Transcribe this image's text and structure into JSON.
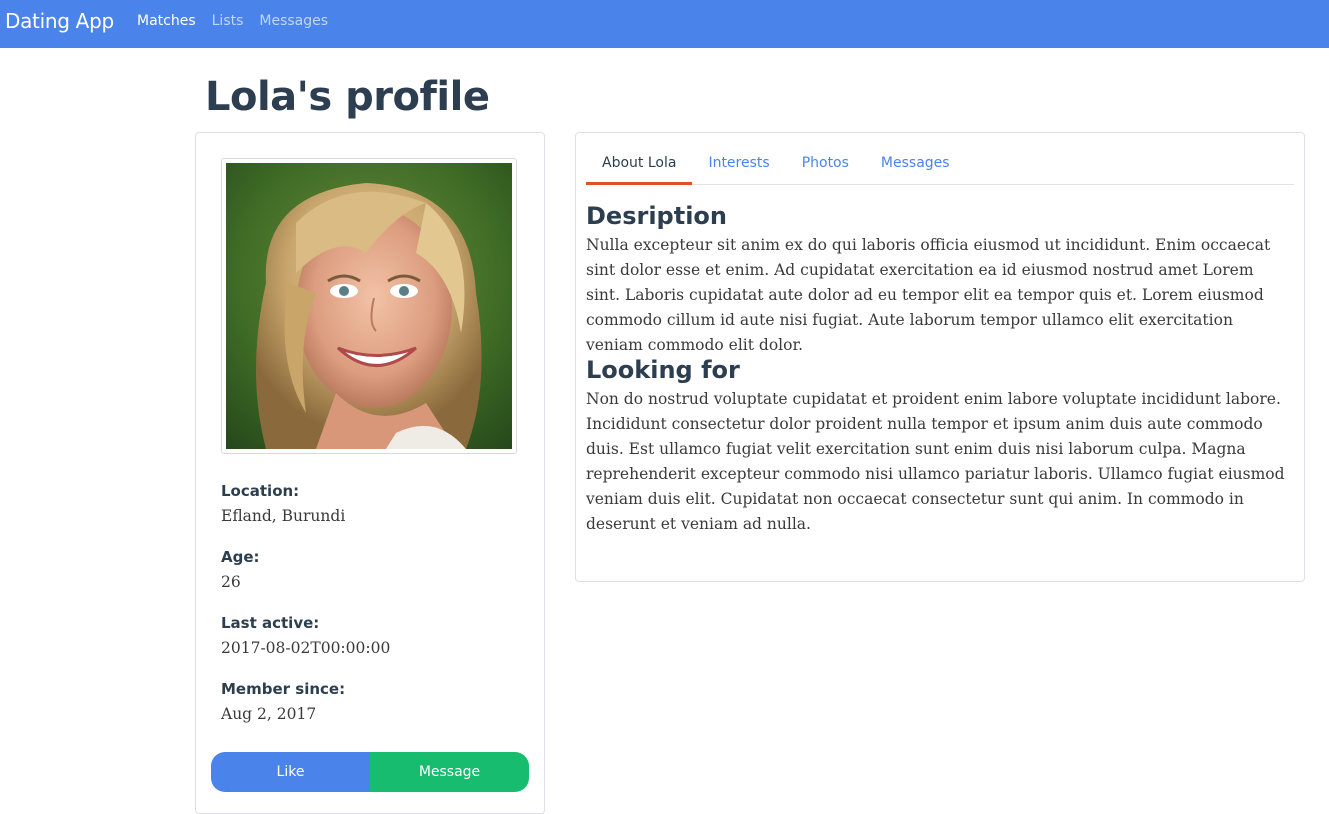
{
  "navbar": {
    "brand": "Dating App",
    "links": [
      {
        "label": "Matches",
        "active": true
      },
      {
        "label": "Lists",
        "active": false
      },
      {
        "label": "Messages",
        "active": false
      }
    ],
    "color": "#4a84ea"
  },
  "page": {
    "title": "Lola's profile"
  },
  "profile": {
    "photo_icon": "profile-photo",
    "fields": [
      {
        "label": "Location:",
        "value": "Efland, Burundi"
      },
      {
        "label": "Age:",
        "value": "26"
      },
      {
        "label": "Last active:",
        "value": "2017-08-02T00:00:00"
      },
      {
        "label": "Member since:",
        "value": "Aug 2, 2017"
      }
    ],
    "buttons": {
      "like": "Like",
      "message": "Message"
    },
    "colors": {
      "like": "#4a84ea",
      "message": "#18bc6f"
    }
  },
  "tabs": [
    {
      "label": "About Lola",
      "active": true
    },
    {
      "label": "Interests",
      "active": false
    },
    {
      "label": "Photos",
      "active": false
    },
    {
      "label": "Messages",
      "active": false
    }
  ],
  "about": {
    "description_heading": "Desription",
    "description_text": "Nulla excepteur sit anim ex do qui laboris officia eiusmod ut incididunt. Enim occaecat sint dolor esse et enim. Ad cupidatat exercitation ea id eiusmod nostrud amet Lorem sint. Laboris cupidatat aute dolor ad eu tempor elit ea tempor quis et. Lorem eiusmod commodo cillum id aute nisi fugiat. Aute laborum tempor ullamco elit exercitation veniam commodo elit dolor.",
    "looking_heading": "Looking for",
    "looking_text": "Non do nostrud voluptate cupidatat et proident enim labore voluptate incididunt labore. Incididunt consectetur dolor proident nulla tempor et ipsum anim duis aute commodo duis. Est ullamco fugiat velit exercitation sunt enim duis nisi laborum culpa. Magna reprehenderit excepteur commodo nisi ullamco pariatur laboris. Ullamco fugiat eiusmod veniam duis elit. Cupidatat non occaecat consectetur sunt qui anim. In commodo in deserunt et veniam ad nulla."
  },
  "accent_tab_color": "#e0512a"
}
